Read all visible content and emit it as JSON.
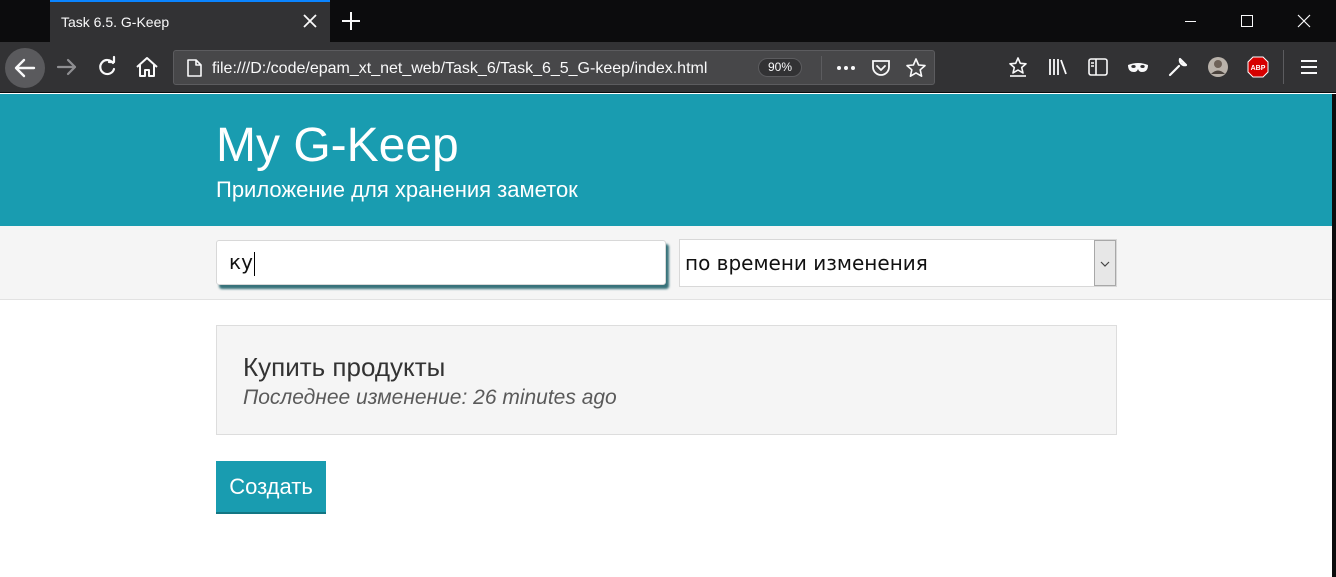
{
  "browser": {
    "tab_title": "Task 6.5. G-Keep",
    "url": "file:///D:/code/epam_xt_net_web/Task_6/Task_6_5_G-keep/index.html",
    "zoom": "90%",
    "abp_label": "ABP"
  },
  "app": {
    "title": "My G-Keep",
    "subtitle": "Приложение для хранения заметок"
  },
  "controls": {
    "search_value": "ку",
    "sort_selected": "по времени изменения"
  },
  "notes": [
    {
      "title": "Купить продукты",
      "meta_label": "Последнее изменение: ",
      "meta_value": "26 minutes ago"
    }
  ],
  "actions": {
    "create_label": "Создать"
  }
}
